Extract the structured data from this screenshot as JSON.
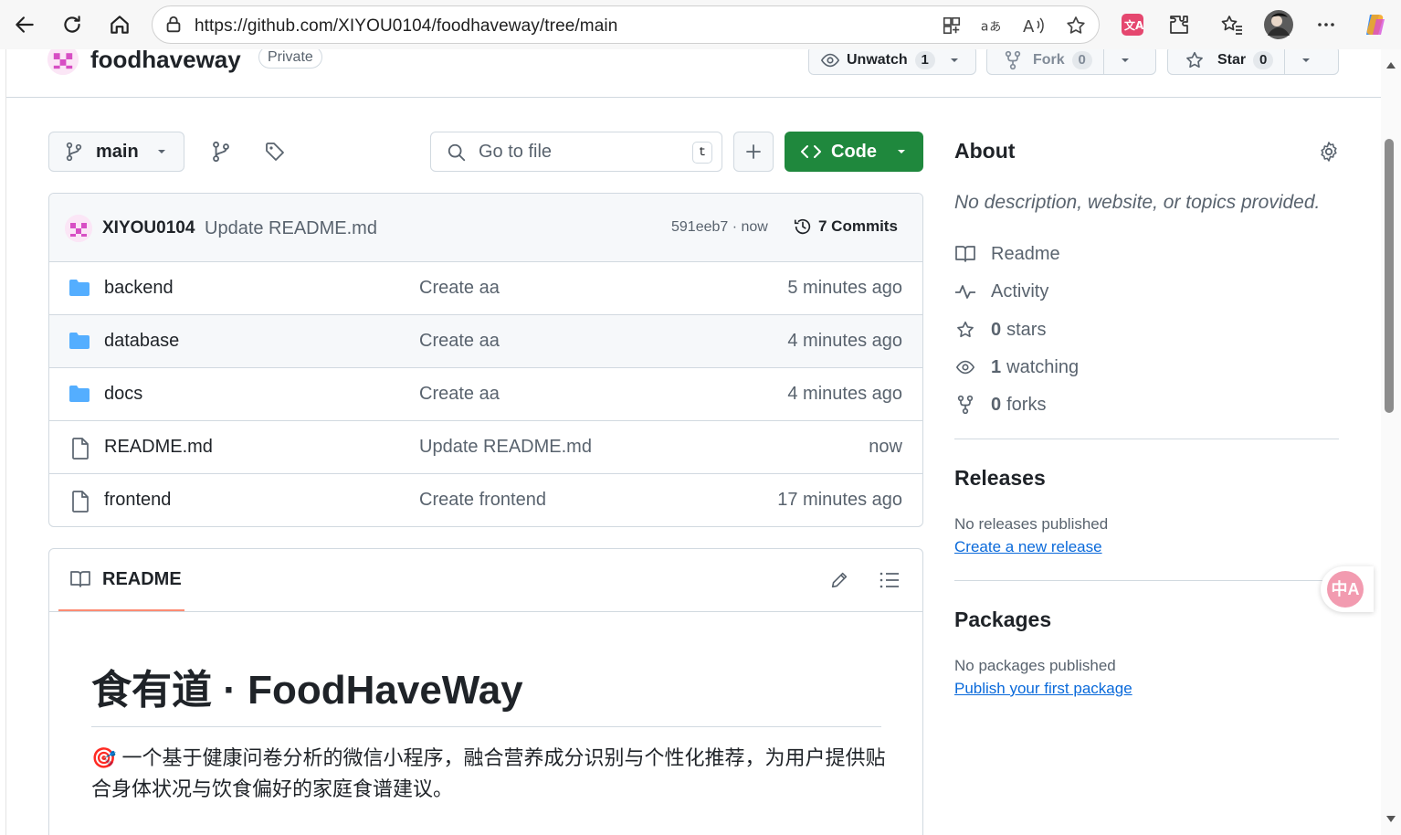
{
  "browser": {
    "url": "https://github.com/XIYOU0104/foodhaveway/tree/main"
  },
  "repo": {
    "name": "foodhaveway",
    "visibility": "Private",
    "unwatch_label": "Unwatch",
    "watch_count": "1",
    "fork_label": "Fork",
    "fork_count": "0",
    "star_label": "Star",
    "star_count": "0"
  },
  "toolbar": {
    "branch": "main",
    "goto_placeholder": "Go to file",
    "goto_shortcut": "t",
    "code_label": "Code"
  },
  "latest_commit": {
    "author": "XIYOU0104",
    "message": "Update README.md",
    "sha_time": "591eeb7 · now",
    "commits_label": "7 Commits"
  },
  "files": [
    {
      "name": "backend",
      "type": "folder",
      "message": "Create aa",
      "age": "5 minutes ago"
    },
    {
      "name": "database",
      "type": "folder",
      "message": "Create aa",
      "age": "4 minutes ago"
    },
    {
      "name": "docs",
      "type": "folder",
      "message": "Create aa",
      "age": "4 minutes ago"
    },
    {
      "name": "README.md",
      "type": "file",
      "message": "Update README.md",
      "age": "now"
    },
    {
      "name": "frontend",
      "type": "file",
      "message": "Create frontend",
      "age": "17 minutes ago"
    }
  ],
  "readme": {
    "tab_label": "README",
    "heading": "食有道 · FoodHaveWay",
    "emoji": "🎯",
    "paragraph": "一个基于健康问卷分析的微信小程序，融合营养成分识别与个性化推荐，为用户提供贴合身体状况与饮食偏好的家庭食谱建议。"
  },
  "about": {
    "title": "About",
    "description": "No description, website, or topics provided.",
    "items": [
      {
        "icon": "book-icon",
        "count": "",
        "label": "Readme"
      },
      {
        "icon": "pulse-icon",
        "count": "",
        "label": "Activity"
      },
      {
        "icon": "star-icon",
        "count": "0",
        "label": "stars"
      },
      {
        "icon": "eye-icon",
        "count": "1",
        "label": "watching"
      },
      {
        "icon": "fork-icon",
        "count": "0",
        "label": "forks"
      }
    ]
  },
  "releases": {
    "title": "Releases",
    "empty": "No releases published",
    "link": "Create a new release"
  },
  "packages": {
    "title": "Packages",
    "empty": "No packages published",
    "link": "Publish your first package"
  },
  "translate_badge": "中A",
  "colors": {
    "code_button": "#1f883d",
    "link": "#0969da",
    "folder": "#54aeff",
    "readme_tab_underline": "#fd8c73"
  }
}
